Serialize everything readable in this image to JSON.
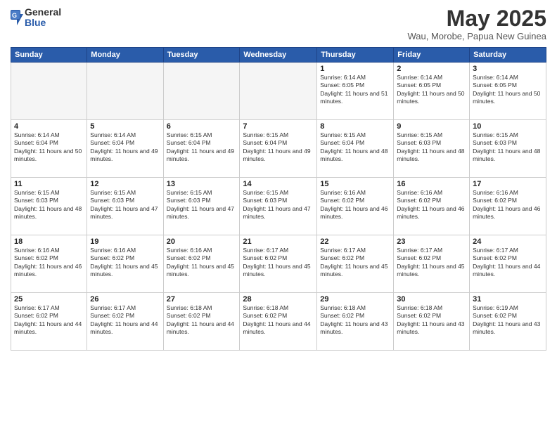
{
  "header": {
    "logo_general": "General",
    "logo_blue": "Blue",
    "month_title": "May 2025",
    "location": "Wau, Morobe, Papua New Guinea"
  },
  "days_of_week": [
    "Sunday",
    "Monday",
    "Tuesday",
    "Wednesday",
    "Thursday",
    "Friday",
    "Saturday"
  ],
  "weeks": [
    [
      {
        "day": "",
        "text": ""
      },
      {
        "day": "",
        "text": ""
      },
      {
        "day": "",
        "text": ""
      },
      {
        "day": "",
        "text": ""
      },
      {
        "day": "1",
        "text": "Sunrise: 6:14 AM\nSunset: 6:05 PM\nDaylight: 11 hours and 51 minutes."
      },
      {
        "day": "2",
        "text": "Sunrise: 6:14 AM\nSunset: 6:05 PM\nDaylight: 11 hours and 50 minutes."
      },
      {
        "day": "3",
        "text": "Sunrise: 6:14 AM\nSunset: 6:05 PM\nDaylight: 11 hours and 50 minutes."
      }
    ],
    [
      {
        "day": "4",
        "text": "Sunrise: 6:14 AM\nSunset: 6:04 PM\nDaylight: 11 hours and 50 minutes."
      },
      {
        "day": "5",
        "text": "Sunrise: 6:14 AM\nSunset: 6:04 PM\nDaylight: 11 hours and 49 minutes."
      },
      {
        "day": "6",
        "text": "Sunrise: 6:15 AM\nSunset: 6:04 PM\nDaylight: 11 hours and 49 minutes."
      },
      {
        "day": "7",
        "text": "Sunrise: 6:15 AM\nSunset: 6:04 PM\nDaylight: 11 hours and 49 minutes."
      },
      {
        "day": "8",
        "text": "Sunrise: 6:15 AM\nSunset: 6:04 PM\nDaylight: 11 hours and 48 minutes."
      },
      {
        "day": "9",
        "text": "Sunrise: 6:15 AM\nSunset: 6:03 PM\nDaylight: 11 hours and 48 minutes."
      },
      {
        "day": "10",
        "text": "Sunrise: 6:15 AM\nSunset: 6:03 PM\nDaylight: 11 hours and 48 minutes."
      }
    ],
    [
      {
        "day": "11",
        "text": "Sunrise: 6:15 AM\nSunset: 6:03 PM\nDaylight: 11 hours and 48 minutes."
      },
      {
        "day": "12",
        "text": "Sunrise: 6:15 AM\nSunset: 6:03 PM\nDaylight: 11 hours and 47 minutes."
      },
      {
        "day": "13",
        "text": "Sunrise: 6:15 AM\nSunset: 6:03 PM\nDaylight: 11 hours and 47 minutes."
      },
      {
        "day": "14",
        "text": "Sunrise: 6:15 AM\nSunset: 6:03 PM\nDaylight: 11 hours and 47 minutes."
      },
      {
        "day": "15",
        "text": "Sunrise: 6:16 AM\nSunset: 6:02 PM\nDaylight: 11 hours and 46 minutes."
      },
      {
        "day": "16",
        "text": "Sunrise: 6:16 AM\nSunset: 6:02 PM\nDaylight: 11 hours and 46 minutes."
      },
      {
        "day": "17",
        "text": "Sunrise: 6:16 AM\nSunset: 6:02 PM\nDaylight: 11 hours and 46 minutes."
      }
    ],
    [
      {
        "day": "18",
        "text": "Sunrise: 6:16 AM\nSunset: 6:02 PM\nDaylight: 11 hours and 46 minutes."
      },
      {
        "day": "19",
        "text": "Sunrise: 6:16 AM\nSunset: 6:02 PM\nDaylight: 11 hours and 45 minutes."
      },
      {
        "day": "20",
        "text": "Sunrise: 6:16 AM\nSunset: 6:02 PM\nDaylight: 11 hours and 45 minutes."
      },
      {
        "day": "21",
        "text": "Sunrise: 6:17 AM\nSunset: 6:02 PM\nDaylight: 11 hours and 45 minutes."
      },
      {
        "day": "22",
        "text": "Sunrise: 6:17 AM\nSunset: 6:02 PM\nDaylight: 11 hours and 45 minutes."
      },
      {
        "day": "23",
        "text": "Sunrise: 6:17 AM\nSunset: 6:02 PM\nDaylight: 11 hours and 45 minutes."
      },
      {
        "day": "24",
        "text": "Sunrise: 6:17 AM\nSunset: 6:02 PM\nDaylight: 11 hours and 44 minutes."
      }
    ],
    [
      {
        "day": "25",
        "text": "Sunrise: 6:17 AM\nSunset: 6:02 PM\nDaylight: 11 hours and 44 minutes."
      },
      {
        "day": "26",
        "text": "Sunrise: 6:17 AM\nSunset: 6:02 PM\nDaylight: 11 hours and 44 minutes."
      },
      {
        "day": "27",
        "text": "Sunrise: 6:18 AM\nSunset: 6:02 PM\nDaylight: 11 hours and 44 minutes."
      },
      {
        "day": "28",
        "text": "Sunrise: 6:18 AM\nSunset: 6:02 PM\nDaylight: 11 hours and 44 minutes."
      },
      {
        "day": "29",
        "text": "Sunrise: 6:18 AM\nSunset: 6:02 PM\nDaylight: 11 hours and 43 minutes."
      },
      {
        "day": "30",
        "text": "Sunrise: 6:18 AM\nSunset: 6:02 PM\nDaylight: 11 hours and 43 minutes."
      },
      {
        "day": "31",
        "text": "Sunrise: 6:19 AM\nSunset: 6:02 PM\nDaylight: 11 hours and 43 minutes."
      }
    ]
  ]
}
